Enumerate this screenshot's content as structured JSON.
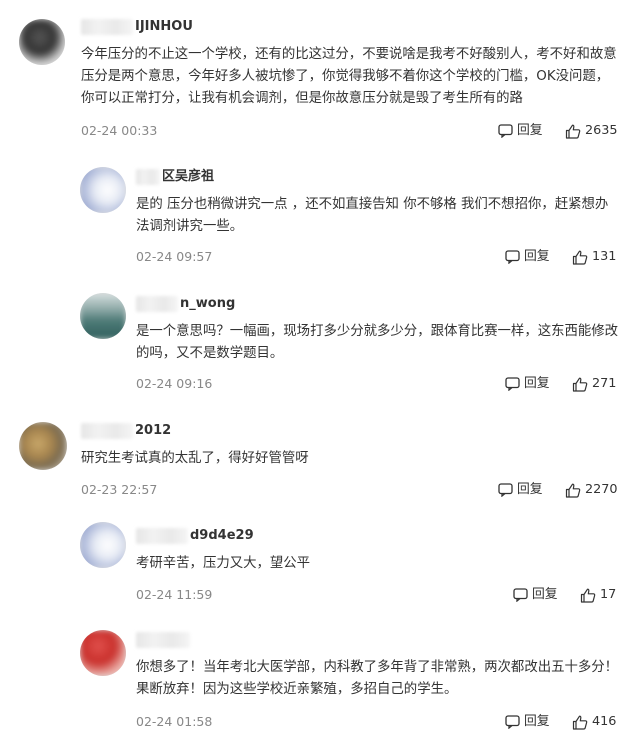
{
  "comments": [
    {
      "name": "IJINHOU",
      "text": "今年压分的不止这一个学校，还有的比这过分，不要说啥是我考不好酸别人，考不好和故意压分是两个意思，今年好多人被坑惨了，你觉得我够不着你这个学校的门槛，OK没问题，你可以正常打分，让我有机会调剂，但是你故意压分就是毁了考生所有的路",
      "time": "02-24 00:33",
      "reply": "回复",
      "likes": "2635"
    },
    {
      "name": "区吴彦祖",
      "text": "是的 压分也稍微讲究一点 ，还不如直接告知 你不够格 我们不想招你，赶紧想办法调剂讲究一些。",
      "time": "02-24 09:57",
      "reply": "回复",
      "likes": "131"
    },
    {
      "name": "n_wong",
      "text": "是一个意思吗？一幅画，现场打多少分就多少分，跟体育比赛一样，这东西能修改的吗，又不是数学题目。",
      "time": "02-24 09:16",
      "reply": "回复",
      "likes": "271"
    },
    {
      "name": "2012",
      "text": "研究生考试真的太乱了，得好好管管呀",
      "time": "02-23 22:57",
      "reply": "回复",
      "likes": "2270"
    },
    {
      "name": "d9d4e29",
      "text": "考研辛苦，压力又大，望公平",
      "time": "02-24 11:59",
      "reply": "回复",
      "likes": "17"
    },
    {
      "name": "",
      "text": "你想多了！当年考北大医学部，内科教了多年背了非常熟，两次都改出五十多分！果断放弃！因为这些学校近亲繁殖，多招自己的学生。",
      "time": "02-24 01:58",
      "reply": "回复",
      "likes": "416"
    }
  ]
}
